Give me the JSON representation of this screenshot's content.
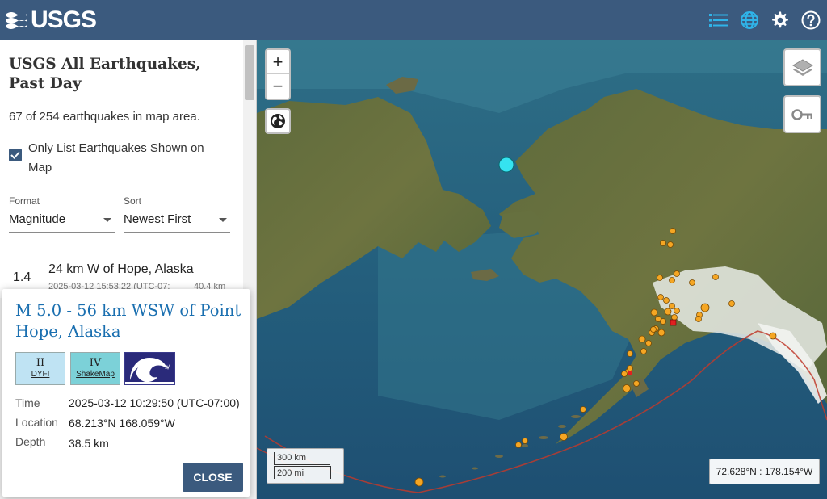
{
  "header": {
    "logo_text": "USGS",
    "icons": [
      "list-icon",
      "globe-icon",
      "gear-icon",
      "help-icon"
    ],
    "accent_color": "#3b5a7e",
    "active_icon_color": "#2fb4e9"
  },
  "sidebar": {
    "title": "USGS All Earthquakes, Past Day",
    "count_text": "67 of 254 earthquakes in map area.",
    "only_list_checkbox": {
      "label": "Only List Earthquakes Shown on Map",
      "checked": true
    },
    "format": {
      "label": "Format",
      "value": "Magnitude"
    },
    "sort": {
      "label": "Sort",
      "value": "Newest First"
    },
    "list": [
      {
        "mag": "1.4",
        "place": "24 km W of Hope, Alaska",
        "time": "2025-03-12 15:53:22 (UTC-07:",
        "depth": "40.4 km"
      }
    ]
  },
  "popup": {
    "title": "M 5.0 - 56 km WSW of Point Hope, Alaska",
    "dyfi": {
      "value": "II",
      "label": "DYFI",
      "color": "#bfe3f3"
    },
    "shakemap": {
      "value": "IV",
      "label": "ShakeMap",
      "color": "#7cd1d8"
    },
    "tsunami_icon": "tsunami-wave-icon",
    "time_label": "Time",
    "time_value": "2025-03-12 10:29:50 (UTC-07:00)",
    "location_label": "Location",
    "location_value": "68.213°N 168.059°W",
    "depth_label": "Depth",
    "depth_value": "38.5 km",
    "close_label": "CLOSE"
  },
  "map": {
    "zoom_in_label": "+",
    "zoom_out_label": "−",
    "scale_km": "300 km",
    "scale_mi": "200 mi",
    "coordinates": "72.628°N : 178.154°W",
    "layer_icon": "layers-icon",
    "key_icon": "key-icon",
    "world_icon": "globe-icon",
    "quake_color": "#f5a623",
    "selected_color": "#35e3f0",
    "plate_boundary_color": "#c0392b"
  }
}
